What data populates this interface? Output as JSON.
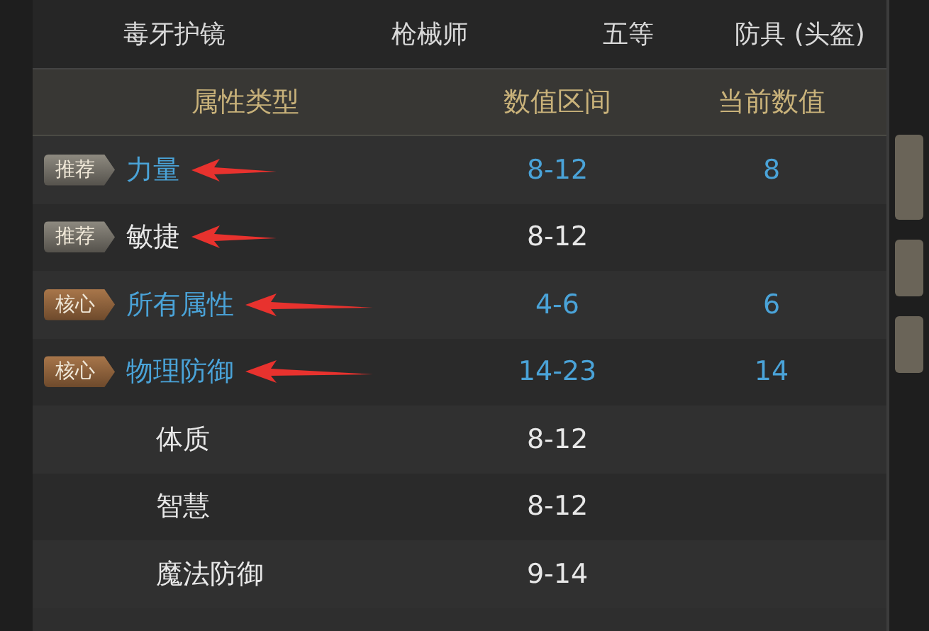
{
  "item": {
    "name": "毒牙护镜",
    "class": "枪械师",
    "grade": "五等",
    "slot": "防具 (头盔)"
  },
  "columns": [
    "属性类型",
    "数值区间",
    "当前数值"
  ],
  "rows": [
    {
      "badge": {
        "kind": "recommend",
        "label": "推荐"
      },
      "name": "力量",
      "range": "8-12",
      "current": "8",
      "highlighted": true,
      "annotated": true
    },
    {
      "badge": {
        "kind": "recommend",
        "label": "推荐"
      },
      "name": "敏捷",
      "range": "8-12",
      "highlighted": false,
      "annotated": true
    },
    {
      "badge": {
        "kind": "core",
        "label": "核心"
      },
      "name": "所有属性",
      "range": "4-6",
      "current": "6",
      "highlighted": true,
      "annotated": true
    },
    {
      "badge": {
        "kind": "core",
        "label": "核心"
      },
      "name": "物理防御",
      "range": "14-23",
      "current": "14",
      "highlighted": true,
      "annotated": true
    },
    {
      "name": "体质",
      "range": "8-12",
      "highlighted": false,
      "annotated": false
    },
    {
      "name": "智慧",
      "range": "8-12",
      "highlighted": false,
      "annotated": false
    },
    {
      "name": "魔法防御",
      "range": "9-14",
      "highlighted": false,
      "annotated": false
    }
  ]
}
